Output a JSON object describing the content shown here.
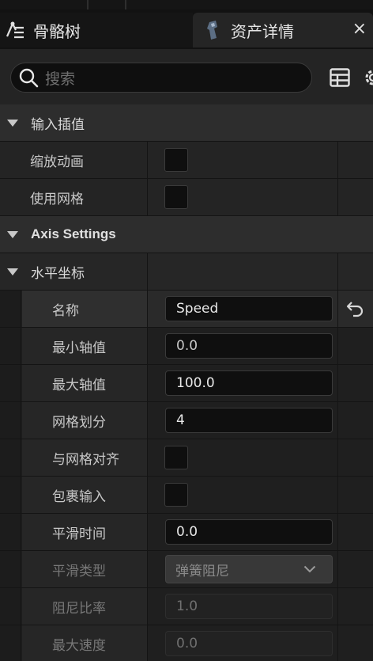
{
  "tabs": [
    {
      "label": "骨骼树",
      "icon": "skeleton-tree-icon"
    },
    {
      "label": "资产详情",
      "icon": "asset-details-icon",
      "close": "×"
    }
  ],
  "search": {
    "placeholder": "搜索"
  },
  "sections": {
    "input_interp": "输入插值",
    "axis_settings": "Axis Settings",
    "horizontal": "水平坐标"
  },
  "props": {
    "scale_anim": "缩放动画",
    "use_grid": "使用网格",
    "name": "名称",
    "min_axis": "最小轴值",
    "max_axis": "最大轴值",
    "grid_div": "网格划分",
    "snap_grid": "与网格对齐",
    "wrap_input": "包裹输入",
    "smooth_time": "平滑时间",
    "smooth_type": "平滑类型",
    "damping_ratio": "阻尼比率",
    "max_speed": "最大速度"
  },
  "values": {
    "name": "Speed",
    "min_axis": "0.0",
    "max_axis": "100.0",
    "grid_div": "4",
    "smooth_time": "0.0",
    "smooth_type": "弹簧阻尼",
    "damping_ratio": "1.0",
    "max_speed": "0.0"
  },
  "checks": {
    "scale_anim": false,
    "use_grid": false,
    "snap_grid": false,
    "wrap_input": false
  },
  "colors": {
    "background": "#242424",
    "field": "#0f0f0f",
    "category": "#2d2d2d"
  }
}
